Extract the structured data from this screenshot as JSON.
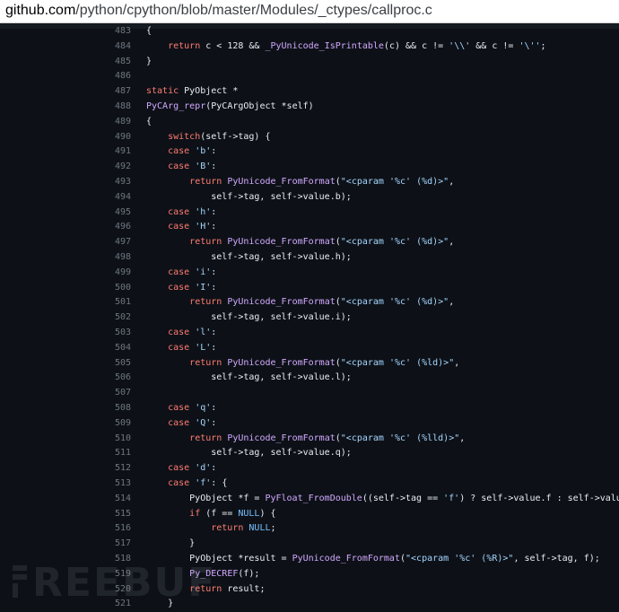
{
  "browser": {
    "url_domain": "github.com",
    "url_path": "/python/cpython/blob/master/Modules/_ctypes/callproc.c"
  },
  "watermark": {
    "text": "REEBUF"
  },
  "colors": {
    "keyword": "#ff7b72",
    "function": "#d2a8ff",
    "string": "#a5d6ff",
    "constant": "#79c0ff",
    "text": "#e6edf3",
    "line_number": "#6e7681",
    "background": "#0d1117"
  },
  "code_lines": [
    {
      "n": "483",
      "segs": [
        [
          "p",
          "{"
        ]
      ]
    },
    {
      "n": "484",
      "segs": [
        [
          "p",
          "    "
        ],
        [
          "k",
          "return"
        ],
        [
          "p",
          " c < 128 && "
        ],
        [
          "f",
          "_PyUnicode_IsPrintable"
        ],
        [
          "p",
          "(c) && c != "
        ],
        [
          "s",
          "'\\\\'"
        ],
        [
          "p",
          " && c != "
        ],
        [
          "s",
          "'\\''"
        ],
        [
          "p",
          ";"
        ]
      ]
    },
    {
      "n": "485",
      "segs": [
        [
          "p",
          "}"
        ]
      ]
    },
    {
      "n": "486",
      "segs": []
    },
    {
      "n": "487",
      "segs": [
        [
          "k",
          "static"
        ],
        [
          "p",
          " PyObject *"
        ]
      ]
    },
    {
      "n": "488",
      "segs": [
        [
          "f",
          "PyCArg_repr"
        ],
        [
          "p",
          "(PyCArgObject *self)"
        ]
      ]
    },
    {
      "n": "489",
      "segs": [
        [
          "p",
          "{"
        ]
      ]
    },
    {
      "n": "490",
      "segs": [
        [
          "p",
          "    "
        ],
        [
          "k",
          "switch"
        ],
        [
          "p",
          "(self->tag) {"
        ]
      ]
    },
    {
      "n": "491",
      "segs": [
        [
          "p",
          "    "
        ],
        [
          "k",
          "case"
        ],
        [
          "p",
          " "
        ],
        [
          "s",
          "'b'"
        ],
        [
          "p",
          ":"
        ]
      ]
    },
    {
      "n": "492",
      "segs": [
        [
          "p",
          "    "
        ],
        [
          "k",
          "case"
        ],
        [
          "p",
          " "
        ],
        [
          "s",
          "'B'"
        ],
        [
          "p",
          ":"
        ]
      ]
    },
    {
      "n": "493",
      "segs": [
        [
          "p",
          "        "
        ],
        [
          "k",
          "return"
        ],
        [
          "p",
          " "
        ],
        [
          "f",
          "PyUnicode_FromFormat"
        ],
        [
          "p",
          "("
        ],
        [
          "s",
          "\"<cparam '%c' (%d)>\""
        ],
        [
          "p",
          ","
        ]
      ]
    },
    {
      "n": "494",
      "segs": [
        [
          "p",
          "            self->tag, self->value.b);"
        ]
      ]
    },
    {
      "n": "495",
      "segs": [
        [
          "p",
          "    "
        ],
        [
          "k",
          "case"
        ],
        [
          "p",
          " "
        ],
        [
          "s",
          "'h'"
        ],
        [
          "p",
          ":"
        ]
      ]
    },
    {
      "n": "496",
      "segs": [
        [
          "p",
          "    "
        ],
        [
          "k",
          "case"
        ],
        [
          "p",
          " "
        ],
        [
          "s",
          "'H'"
        ],
        [
          "p",
          ":"
        ]
      ]
    },
    {
      "n": "497",
      "segs": [
        [
          "p",
          "        "
        ],
        [
          "k",
          "return"
        ],
        [
          "p",
          " "
        ],
        [
          "f",
          "PyUnicode_FromFormat"
        ],
        [
          "p",
          "("
        ],
        [
          "s",
          "\"<cparam '%c' (%d)>\""
        ],
        [
          "p",
          ","
        ]
      ]
    },
    {
      "n": "498",
      "segs": [
        [
          "p",
          "            self->tag, self->value.h);"
        ]
      ]
    },
    {
      "n": "499",
      "segs": [
        [
          "p",
          "    "
        ],
        [
          "k",
          "case"
        ],
        [
          "p",
          " "
        ],
        [
          "s",
          "'i'"
        ],
        [
          "p",
          ":"
        ]
      ]
    },
    {
      "n": "500",
      "segs": [
        [
          "p",
          "    "
        ],
        [
          "k",
          "case"
        ],
        [
          "p",
          " "
        ],
        [
          "s",
          "'I'"
        ],
        [
          "p",
          ":"
        ]
      ]
    },
    {
      "n": "501",
      "segs": [
        [
          "p",
          "        "
        ],
        [
          "k",
          "return"
        ],
        [
          "p",
          " "
        ],
        [
          "f",
          "PyUnicode_FromFormat"
        ],
        [
          "p",
          "("
        ],
        [
          "s",
          "\"<cparam '%c' (%d)>\""
        ],
        [
          "p",
          ","
        ]
      ]
    },
    {
      "n": "502",
      "segs": [
        [
          "p",
          "            self->tag, self->value.i);"
        ]
      ]
    },
    {
      "n": "503",
      "segs": [
        [
          "p",
          "    "
        ],
        [
          "k",
          "case"
        ],
        [
          "p",
          " "
        ],
        [
          "s",
          "'l'"
        ],
        [
          "p",
          ":"
        ]
      ]
    },
    {
      "n": "504",
      "segs": [
        [
          "p",
          "    "
        ],
        [
          "k",
          "case"
        ],
        [
          "p",
          " "
        ],
        [
          "s",
          "'L'"
        ],
        [
          "p",
          ":"
        ]
      ]
    },
    {
      "n": "505",
      "segs": [
        [
          "p",
          "        "
        ],
        [
          "k",
          "return"
        ],
        [
          "p",
          " "
        ],
        [
          "f",
          "PyUnicode_FromFormat"
        ],
        [
          "p",
          "("
        ],
        [
          "s",
          "\"<cparam '%c' (%ld)>\""
        ],
        [
          "p",
          ","
        ]
      ]
    },
    {
      "n": "506",
      "segs": [
        [
          "p",
          "            self->tag, self->value.l);"
        ]
      ]
    },
    {
      "n": "507",
      "segs": []
    },
    {
      "n": "508",
      "segs": [
        [
          "p",
          "    "
        ],
        [
          "k",
          "case"
        ],
        [
          "p",
          " "
        ],
        [
          "s",
          "'q'"
        ],
        [
          "p",
          ":"
        ]
      ]
    },
    {
      "n": "509",
      "segs": [
        [
          "p",
          "    "
        ],
        [
          "k",
          "case"
        ],
        [
          "p",
          " "
        ],
        [
          "s",
          "'Q'"
        ],
        [
          "p",
          ":"
        ]
      ]
    },
    {
      "n": "510",
      "segs": [
        [
          "p",
          "        "
        ],
        [
          "k",
          "return"
        ],
        [
          "p",
          " "
        ],
        [
          "f",
          "PyUnicode_FromFormat"
        ],
        [
          "p",
          "("
        ],
        [
          "s",
          "\"<cparam '%c' (%lld)>\""
        ],
        [
          "p",
          ","
        ]
      ]
    },
    {
      "n": "511",
      "segs": [
        [
          "p",
          "            self->tag, self->value.q);"
        ]
      ]
    },
    {
      "n": "512",
      "segs": [
        [
          "p",
          "    "
        ],
        [
          "k",
          "case"
        ],
        [
          "p",
          " "
        ],
        [
          "s",
          "'d'"
        ],
        [
          "p",
          ":"
        ]
      ]
    },
    {
      "n": "513",
      "segs": [
        [
          "p",
          "    "
        ],
        [
          "k",
          "case"
        ],
        [
          "p",
          " "
        ],
        [
          "s",
          "'f'"
        ],
        [
          "p",
          ": {"
        ]
      ]
    },
    {
      "n": "514",
      "segs": [
        [
          "p",
          "        PyObject *f = "
        ],
        [
          "f",
          "PyFloat_FromDouble"
        ],
        [
          "p",
          "((self->tag == "
        ],
        [
          "s",
          "'f'"
        ],
        [
          "p",
          ") ? self->value.f : self->value.d);"
        ]
      ]
    },
    {
      "n": "515",
      "segs": [
        [
          "p",
          "        "
        ],
        [
          "k",
          "if"
        ],
        [
          "p",
          " (f == "
        ],
        [
          "c",
          "NULL"
        ],
        [
          "p",
          ") {"
        ]
      ]
    },
    {
      "n": "516",
      "segs": [
        [
          "p",
          "            "
        ],
        [
          "k",
          "return"
        ],
        [
          "p",
          " "
        ],
        [
          "c",
          "NULL"
        ],
        [
          "p",
          ";"
        ]
      ]
    },
    {
      "n": "517",
      "segs": [
        [
          "p",
          "        }"
        ]
      ]
    },
    {
      "n": "518",
      "segs": [
        [
          "p",
          "        PyObject *result = "
        ],
        [
          "f",
          "PyUnicode_FromFormat"
        ],
        [
          "p",
          "("
        ],
        [
          "s",
          "\"<cparam '%c' (%R)>\""
        ],
        [
          "p",
          ", self->tag, f);"
        ]
      ]
    },
    {
      "n": "519",
      "segs": [
        [
          "p",
          "        "
        ],
        [
          "f",
          "Py_DECREF"
        ],
        [
          "p",
          "(f);"
        ]
      ]
    },
    {
      "n": "520",
      "segs": [
        [
          "p",
          "        "
        ],
        [
          "k",
          "return"
        ],
        [
          "p",
          " result;"
        ]
      ]
    },
    {
      "n": "521",
      "segs": [
        [
          "p",
          "    }"
        ]
      ]
    }
  ]
}
